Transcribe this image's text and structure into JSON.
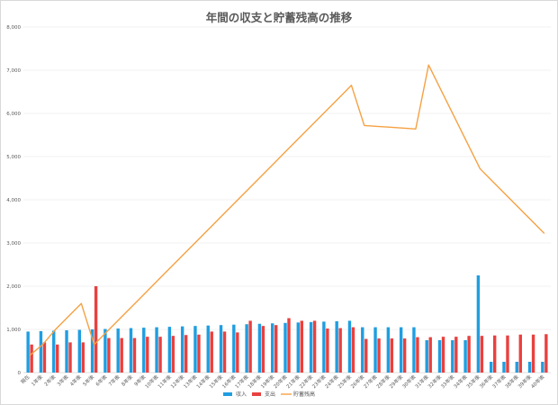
{
  "chart_data": {
    "type": "bar",
    "title": "年間の収支と貯蓄残高の推移",
    "xlabel": "",
    "ylabel": "",
    "ylim": [
      0,
      8000
    ],
    "yticks": [
      "0",
      "1,000",
      "2,000",
      "3,000",
      "4,000",
      "5,000",
      "6,000",
      "7,000",
      "8,000"
    ],
    "grid": true,
    "legend_position": "bottom",
    "categories": [
      "現在",
      "1年後",
      "2年後",
      "3年後",
      "4年後",
      "5年後",
      "6年後",
      "7年後",
      "8年後",
      "9年後",
      "10年後",
      "11年後",
      "12年後",
      "13年後",
      "14年後",
      "15年後",
      "16年後",
      "17年後",
      "18年後",
      "19年後",
      "20年後",
      "21年後",
      "22年後",
      "23年後",
      "24年後",
      "25年後",
      "26年後",
      "27年後",
      "28年後",
      "29年後",
      "30年後",
      "31年後",
      "32年後",
      "33年後",
      "34年後",
      "35年後",
      "36年後",
      "37年後",
      "38年後",
      "39年後",
      "40年後"
    ],
    "series": [
      {
        "name": "収入",
        "type": "bar",
        "color": "#1f9ee0",
        "values": [
          950,
          960,
          970,
          980,
          990,
          1000,
          1010,
          1020,
          1030,
          1040,
          1050,
          1060,
          1070,
          1080,
          1090,
          1100,
          1110,
          1120,
          1130,
          1140,
          1150,
          1160,
          1170,
          1180,
          1190,
          1200,
          1050,
          1050,
          1050,
          1050,
          1050,
          750,
          750,
          750,
          750,
          2250,
          250,
          250,
          250,
          250,
          250
        ]
      },
      {
        "name": "支出",
        "type": "bar",
        "color": "#e8413f",
        "values": [
          650,
          700,
          650,
          700,
          700,
          2000,
          800,
          800,
          800,
          830,
          830,
          850,
          870,
          880,
          950,
          950,
          930,
          1200,
          1080,
          1100,
          1260,
          1200,
          1200,
          1020,
          1030,
          1050,
          780,
          790,
          790,
          790,
          820,
          820,
          830,
          830,
          850,
          850,
          860,
          860,
          880,
          880,
          890
        ]
      },
      {
        "name": "貯蓄残高",
        "type": "line",
        "color": "#f5a143",
        "values": [
          400,
          650,
          1000,
          1300,
          1600,
          650,
          950,
          1250,
          1550,
          1850,
          2150,
          2450,
          2750,
          3050,
          3350,
          3650,
          3950,
          4250,
          4550,
          4850,
          5150,
          5450,
          5750,
          6050,
          6350,
          6650,
          5720,
          5700,
          5680,
          5660,
          5640,
          7120,
          6520,
          5920,
          5320,
          4720,
          4420,
          4120,
          3820,
          3520,
          3220
        ]
      }
    ]
  }
}
